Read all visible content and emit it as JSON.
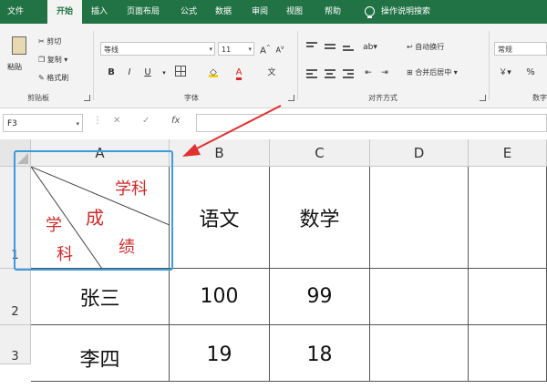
{
  "tabs": [
    "文件",
    "开始",
    "插入",
    "页面布局",
    "公式",
    "数据",
    "审阅",
    "视图",
    "帮助"
  ],
  "tell_me": "操作说明搜索",
  "clipboard": {
    "paste": "粘贴",
    "cut": "剪切",
    "copy": "复制",
    "format_painter": "格式刷",
    "group": "剪贴板"
  },
  "font": {
    "name": "等线",
    "size": "11",
    "bold": "B",
    "italic": "I",
    "underline": "U",
    "grow": "A",
    "shrink": "A",
    "wen": "文",
    "group": "字体"
  },
  "alignment": {
    "wrap": "自动换行",
    "merge": "合并后居中",
    "group": "对齐方式"
  },
  "number": {
    "format": "常规",
    "percent": "%",
    "group": "数字"
  },
  "formula_bar": {
    "name_box": "F3",
    "cancel": "✕",
    "enter": "✓",
    "fx": "fx",
    "value": ""
  },
  "columns": [
    "A",
    "B",
    "C",
    "D",
    "E"
  ],
  "rows": [
    "1",
    "2",
    "3"
  ],
  "header_cell": {
    "top_right": "学科",
    "middle": "成",
    "bottom": "绩",
    "left_top": "学",
    "left_bottom": "科"
  },
  "table": {
    "row1": [
      "语文",
      "数学",
      "",
      ""
    ],
    "row2": [
      "张三",
      "100",
      "99",
      "",
      ""
    ],
    "row3": [
      "李四",
      "19",
      "18",
      "",
      ""
    ]
  },
  "colors": {
    "ribbon_green": "#217346",
    "highlight_blue": "#3b9bdc",
    "arrow_red": "#e03030",
    "cell_red": "#cc2a2a"
  }
}
